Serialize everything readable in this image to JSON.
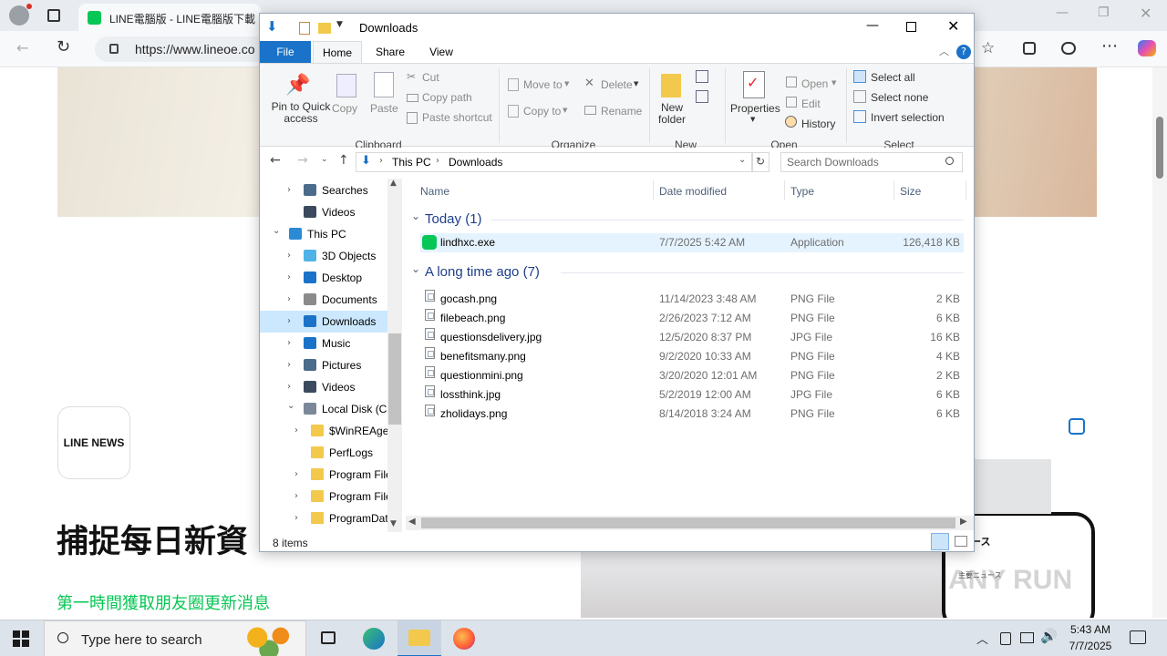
{
  "browser": {
    "tab_title": "LINE電腦版 - LINE電腦版下載",
    "url": "https://www.lineoe.co",
    "window_controls": [
      "minimize",
      "restore",
      "close"
    ]
  },
  "webpage": {
    "logo_text": "LINE NEWS",
    "heading": "捕捉每日新資",
    "subheading": "第一時間獲取朋友圈更新消息",
    "phone_title": "ース",
    "phone_top_news": "主要ニュース",
    "watermark": "ANY RUN"
  },
  "explorer": {
    "title": "Downloads",
    "tabs": [
      "File",
      "Home",
      "Share",
      "View"
    ],
    "ribbon": {
      "clipboard": {
        "pin": "Pin to Quick access",
        "copy": "Copy",
        "paste": "Paste",
        "cut": "Cut",
        "copy_path": "Copy path",
        "paste_shortcut": "Paste shortcut",
        "group": "Clipboard"
      },
      "organize": {
        "move_to": "Move to",
        "copy_to": "Copy to",
        "delete": "Delete",
        "rename": "Rename",
        "group": "Organize"
      },
      "new": {
        "new_folder": "New folder",
        "group": "New"
      },
      "open": {
        "properties": "Properties",
        "open": "Open",
        "edit": "Edit",
        "history": "History",
        "group": "Open"
      },
      "select": {
        "select_all": "Select all",
        "select_none": "Select none",
        "invert": "Invert selection",
        "group": "Select"
      }
    },
    "breadcrumb": [
      "This PC",
      "Downloads"
    ],
    "search_placeholder": "Search Downloads",
    "tree": [
      {
        "label": "Searches",
        "icon": "search-icon",
        "indent": 1,
        "arrow": ">"
      },
      {
        "label": "Videos",
        "icon": "video-icon",
        "indent": 1,
        "arrow": ""
      },
      {
        "label": "This PC",
        "icon": "pc-icon",
        "indent": 0,
        "arrow": "v"
      },
      {
        "label": "3D Objects",
        "icon": "cube-icon",
        "indent": 1,
        "arrow": ">"
      },
      {
        "label": "Desktop",
        "icon": "desktop-icon",
        "indent": 1,
        "arrow": ">"
      },
      {
        "label": "Documents",
        "icon": "document-icon",
        "indent": 1,
        "arrow": ">"
      },
      {
        "label": "Downloads",
        "icon": "download-icon",
        "indent": 1,
        "arrow": ">",
        "selected": true
      },
      {
        "label": "Music",
        "icon": "music-icon",
        "indent": 1,
        "arrow": ">"
      },
      {
        "label": "Pictures",
        "icon": "picture-icon",
        "indent": 1,
        "arrow": ">"
      },
      {
        "label": "Videos",
        "icon": "video-icon",
        "indent": 1,
        "arrow": ">"
      },
      {
        "label": "Local Disk (C:)",
        "icon": "drive-icon",
        "indent": 1,
        "arrow": "v"
      },
      {
        "label": "$WinREAgent",
        "icon": "folder-icon",
        "indent": 2,
        "arrow": ">"
      },
      {
        "label": "PerfLogs",
        "icon": "folder-icon",
        "indent": 2,
        "arrow": ""
      },
      {
        "label": "Program Files",
        "icon": "folder-icon",
        "indent": 2,
        "arrow": ">"
      },
      {
        "label": "Program Files",
        "icon": "folder-icon",
        "indent": 2,
        "arrow": ">"
      },
      {
        "label": "ProgramData",
        "icon": "folder-icon",
        "indent": 2,
        "arrow": ">"
      }
    ],
    "columns": [
      "Name",
      "Date modified",
      "Type",
      "Size"
    ],
    "groups": [
      {
        "label": "Today (1)",
        "files": [
          {
            "name": "lindhxc.exe",
            "date": "7/7/2025 5:42 AM",
            "type": "Application",
            "size": "126,418 KB",
            "icon": "line-app-icon"
          }
        ]
      },
      {
        "label": "A long time ago (7)",
        "files": [
          {
            "name": "gocash.png",
            "date": "11/14/2023 3:48 AM",
            "type": "PNG File",
            "size": "2 KB",
            "icon": "image-file-icon"
          },
          {
            "name": "filebeach.png",
            "date": "2/26/2023 7:12 AM",
            "type": "PNG File",
            "size": "6 KB",
            "icon": "image-file-icon"
          },
          {
            "name": "questionsdelivery.jpg",
            "date": "12/5/2020 8:37 PM",
            "type": "JPG File",
            "size": "16 KB",
            "icon": "image-file-icon"
          },
          {
            "name": "benefitsmany.png",
            "date": "9/2/2020 10:33 AM",
            "type": "PNG File",
            "size": "4 KB",
            "icon": "image-file-icon"
          },
          {
            "name": "questionmini.png",
            "date": "3/20/2020 12:01 AM",
            "type": "PNG File",
            "size": "2 KB",
            "icon": "image-file-icon"
          },
          {
            "name": "lossthink.jpg",
            "date": "5/2/2019 12:00 AM",
            "type": "JPG File",
            "size": "6 KB",
            "icon": "image-file-icon"
          },
          {
            "name": "zholidays.png",
            "date": "8/14/2018 3:24 AM",
            "type": "PNG File",
            "size": "6 KB",
            "icon": "image-file-icon"
          }
        ]
      }
    ],
    "status": "8 items"
  },
  "taskbar": {
    "search_placeholder": "Type here to search",
    "time": "5:43 AM",
    "date": "7/7/2025"
  },
  "colors": {
    "accent": "#1a73c8",
    "selected_row": "#cce8ff",
    "line_green": "#06c755"
  }
}
